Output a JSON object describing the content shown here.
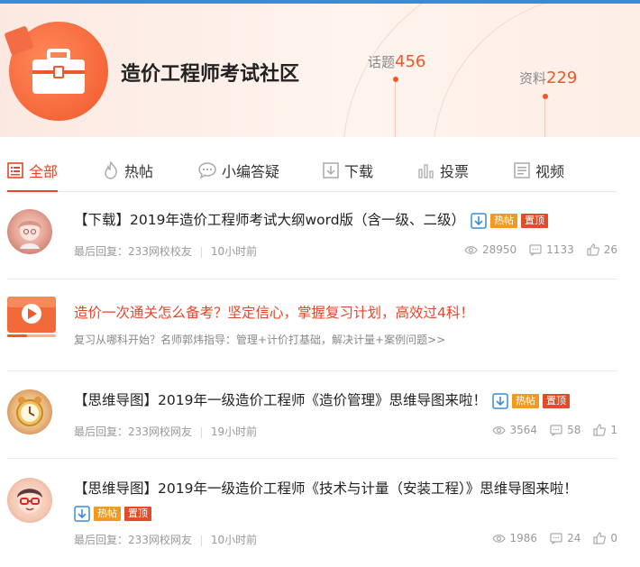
{
  "community": {
    "title": "造价工程师考试社区",
    "topics_label": "话题",
    "topics_count": "456",
    "materials_label": "资料",
    "materials_count": "229"
  },
  "tabs": [
    {
      "label": "全部",
      "icon": "list-icon"
    },
    {
      "label": "热帖",
      "icon": "flame-icon"
    },
    {
      "label": "小编答疑",
      "icon": "chat-icon"
    },
    {
      "label": "下载",
      "icon": "download-icon"
    },
    {
      "label": "投票",
      "icon": "bar-chart-icon"
    },
    {
      "label": "视频",
      "icon": "video-icon"
    }
  ],
  "badges": {
    "hot": "热帖",
    "top": "置顶"
  },
  "posts": [
    {
      "title": "【下载】2019年造价工程师考试大纲word版（含一级、二级）",
      "last_reply_label": "最后回复：233网校校友",
      "time": "10小时前",
      "views": "28950",
      "comments": "1133",
      "likes": "26"
    },
    {
      "title": "【思维导图】2019年一级造价工程师《造价管理》思维导图来啦！",
      "last_reply_label": "最后回复：233网校网友",
      "time": "19小时前",
      "views": "3564",
      "comments": "58",
      "likes": "1"
    },
    {
      "title": "【思维导图】2019年一级造价工程师《技术与计量（安装工程）》思维导图来啦！",
      "last_reply_label": "最后回复：233网校网友",
      "time": "10小时前",
      "views": "1986",
      "comments": "24",
      "likes": "0"
    }
  ],
  "promo": {
    "title": "造价一次通关怎么备考？坚定信心，掌握复习计划，高效过4科！",
    "subtitle": "复习从哪科开始？名师郭炜指导：管理+计价打基础，解决计量+案例问题>>"
  },
  "colors": {
    "accent": "#e6452a",
    "hot": "#f39a1e",
    "top": "#e34c2a",
    "link_blue": "#3a8bd6"
  }
}
